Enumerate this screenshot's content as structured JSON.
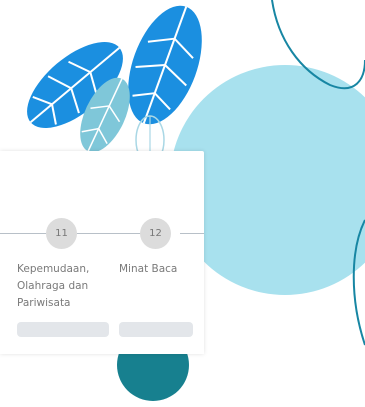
{
  "steps": [
    {
      "number": "11",
      "label": "Kepemudaan, Olahraga dan Pariwisata"
    },
    {
      "number": "12",
      "label": "Minat Baca"
    }
  ],
  "colors": {
    "leaf_blue": "#1b8fe0",
    "leaf_pale": "#7fc7d9",
    "blob_light": "#a8e1ee",
    "blob_teal": "#17808f",
    "line_teal": "#1786a3"
  }
}
